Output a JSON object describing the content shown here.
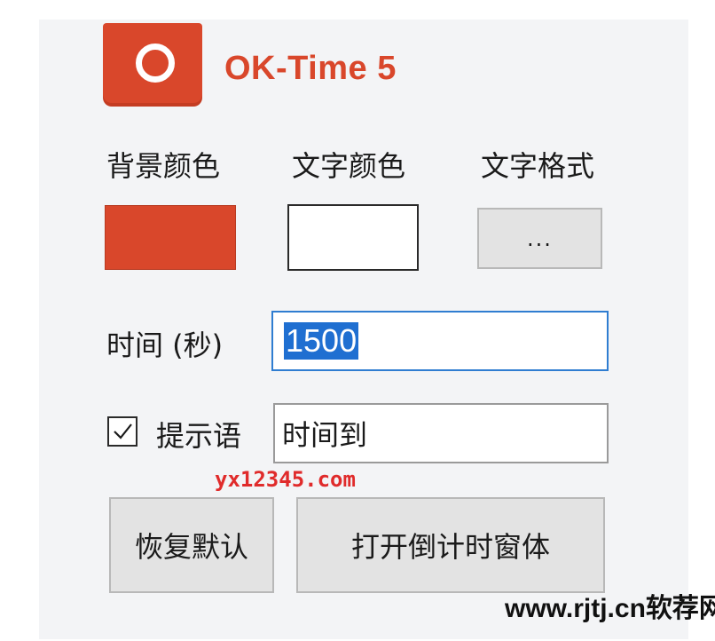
{
  "app": {
    "title": "OK-Time 5"
  },
  "labels": {
    "background_color": "背景颜色",
    "text_color": "文字颜色",
    "text_format": "文字格式",
    "time_seconds": "时间 (秒)",
    "prompt": "提示语"
  },
  "colors": {
    "background_swatch": "#d9472b",
    "text_swatch": "#ffffff",
    "accent": "#d9472b"
  },
  "buttons": {
    "format_label": "...",
    "reset_label": "恢复默认",
    "open_label": "打开倒计时窗体"
  },
  "inputs": {
    "time_value": "1500",
    "prompt_value": "时间到",
    "prompt_checked": true
  },
  "watermarks": {
    "site1": "yx12345.com",
    "site2": "www.rjtj.cn软荐网"
  },
  "icons": {
    "logo": "ring-logo-icon",
    "check": "checkmark-icon"
  }
}
